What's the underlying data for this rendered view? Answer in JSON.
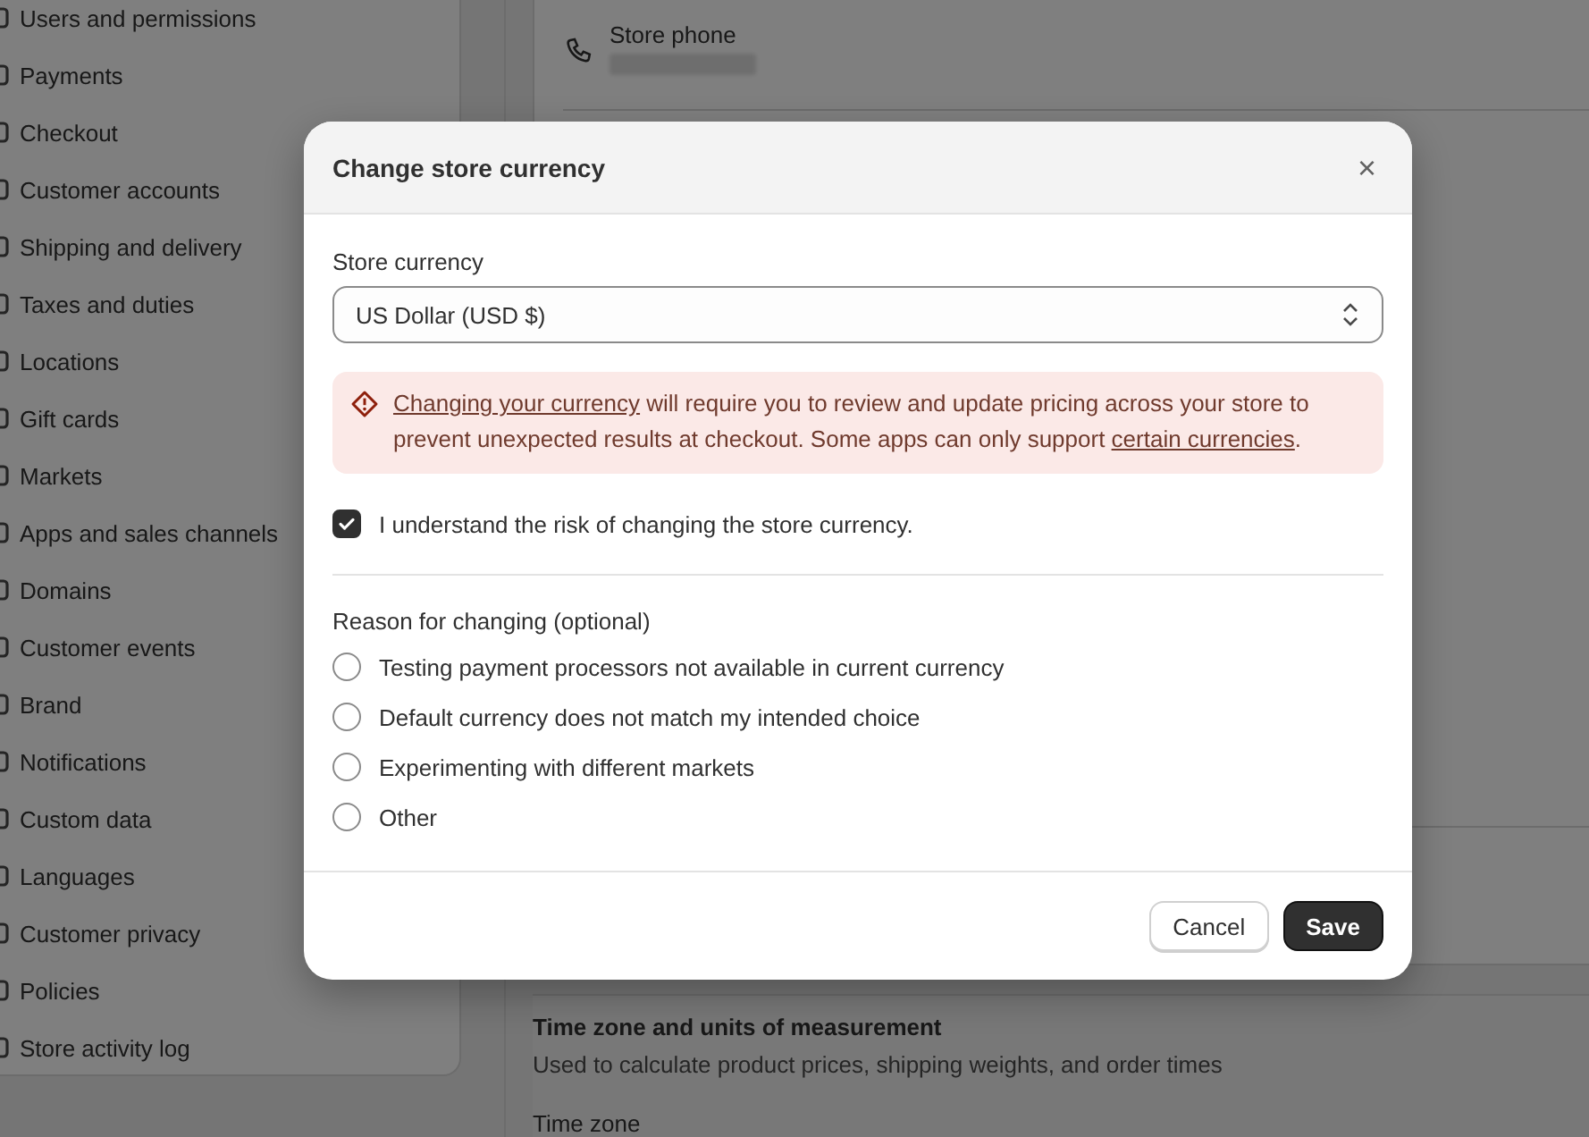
{
  "sidebar": {
    "items": [
      {
        "label": "Users and permissions"
      },
      {
        "label": "Payments"
      },
      {
        "label": "Checkout"
      },
      {
        "label": "Customer accounts"
      },
      {
        "label": "Shipping and delivery"
      },
      {
        "label": "Taxes and duties"
      },
      {
        "label": "Locations"
      },
      {
        "label": "Gift cards"
      },
      {
        "label": "Markets"
      },
      {
        "label": "Apps and sales channels"
      },
      {
        "label": "Domains"
      },
      {
        "label": "Customer events"
      },
      {
        "label": "Brand"
      },
      {
        "label": "Notifications"
      },
      {
        "label": "Custom data"
      },
      {
        "label": "Languages"
      },
      {
        "label": "Customer privacy"
      },
      {
        "label": "Policies"
      },
      {
        "label": "Store activity log"
      }
    ]
  },
  "store_details": {
    "phone_label": "Store phone"
  },
  "time_zone_section": {
    "title": "Time zone and units of measurement",
    "description": "Used to calculate product prices, shipping weights, and order times",
    "field_label": "Time zone"
  },
  "dialog": {
    "title": "Change store currency",
    "close": "×",
    "store_currency": {
      "label": "Store currency",
      "value": "US Dollar (USD $)"
    },
    "warning": [
      {
        "kind": "link",
        "text": "Changing your currency"
      },
      {
        "kind": "text",
        "text": " will require you to review and update pricing across your store to prevent unexpected results at checkout. Some apps can only support "
      },
      {
        "kind": "link",
        "text": "certain currencies"
      },
      {
        "kind": "text",
        "text": "."
      }
    ],
    "confirm": {
      "label": "I understand the risk of changing the store currency.",
      "checked": true
    },
    "reason": {
      "label": "Reason for changing (optional)",
      "options": [
        {
          "label": "Testing payment processors not available in current currency",
          "selected": false
        },
        {
          "label": "Default currency does not match my intended choice",
          "selected": false
        },
        {
          "label": "Experimenting with different markets",
          "selected": false
        },
        {
          "label": "Other",
          "selected": false
        }
      ]
    },
    "buttons": [
      {
        "label": "Cancel",
        "kind": "secondary"
      },
      {
        "label": "Save",
        "kind": "primary"
      }
    ]
  }
}
